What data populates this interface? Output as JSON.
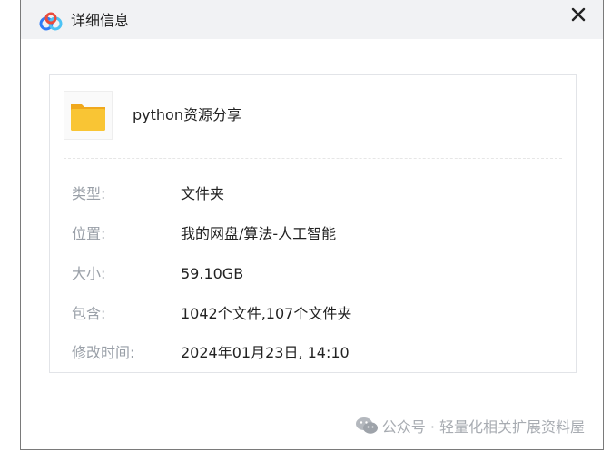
{
  "dialog": {
    "title": "详细信息",
    "logo_icon": "baidu-netdisk-logo-icon",
    "close_icon": "close-icon"
  },
  "file": {
    "icon": "folder-icon",
    "name": "python资源分享"
  },
  "details": [
    {
      "label": "类型:",
      "value": "文件夹"
    },
    {
      "label": "位置:",
      "value": "我的网盘/算法-人工智能"
    },
    {
      "label": "大小:",
      "value": "59.10GB"
    },
    {
      "label": "包含:",
      "value": "1042个文件,107个文件夹"
    },
    {
      "label": "修改时间:",
      "value": "2024年01月23日, 14:10"
    }
  ],
  "watermark": {
    "icon": "wechat-icon",
    "text": "公众号 · 轻量化相关扩展资料屋"
  },
  "colors": {
    "titlebar_bg": "#f1f2f4",
    "label": "#9aa0a8",
    "value": "#222222",
    "folder": "#f7c02b",
    "logo_blue": "#2f7cf6"
  }
}
